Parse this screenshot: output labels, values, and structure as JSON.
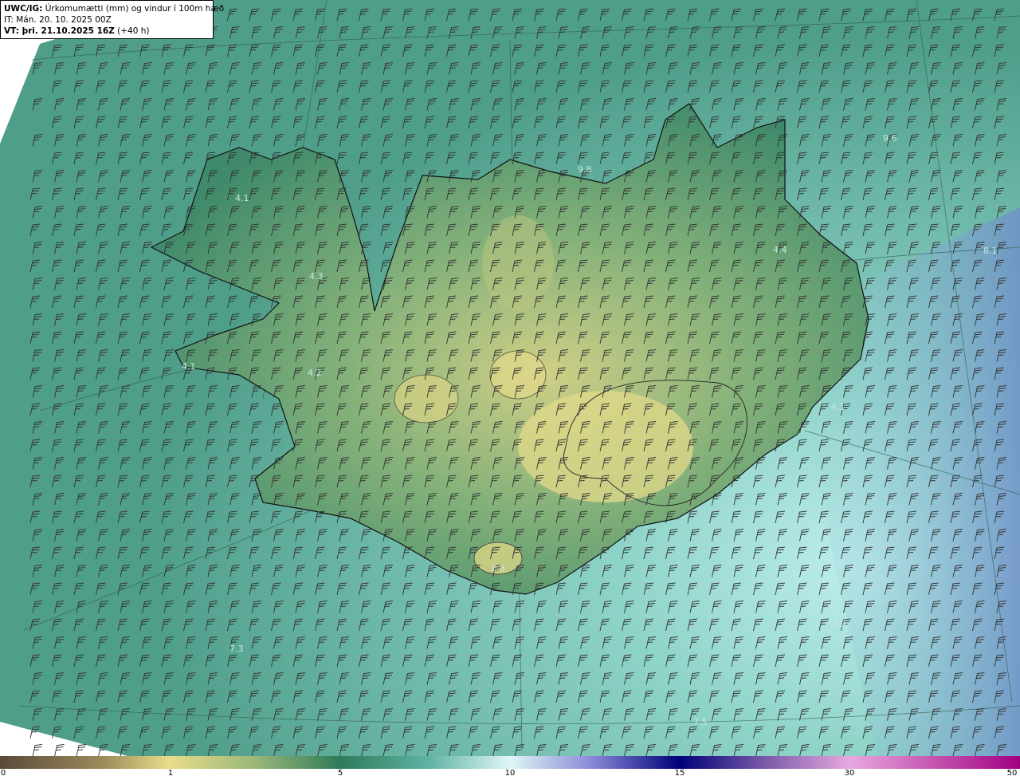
{
  "header": {
    "model_label": "UWC/IG:",
    "title": "Úrkomumætti (mm) og vindur í 100m hæð",
    "it_label": "IT:",
    "it_value": "Mán. 20. 10. 2025 00Z",
    "vt_label": "VT: þri. 21.10.2025 16Z",
    "vt_offset": "(+40 h)"
  },
  "map": {
    "values": [
      "4.1",
      "4.4",
      "4.1",
      "4.3",
      "4.2",
      "4.1",
      "2.8",
      "7.3",
      "7.5",
      "7.9",
      "9.6",
      "8.1",
      "9.8"
    ],
    "land_colors": {
      "ocean": "#5fb3a4",
      "ocean_light": "#a8e0da",
      "land_high": "#3f8a6b",
      "land_mid": "#7fb07a",
      "land_dry": "#d7d68f"
    }
  },
  "colorbar": {
    "ticks": [
      "0",
      "1",
      "5",
      "10",
      "15",
      "30",
      "50"
    ],
    "colors": [
      "#5a4a3a",
      "#c8b86a",
      "#e8e08a",
      "#2e7a5a",
      "#5fb3a4",
      "#dff6f6",
      "#6a6ad0",
      "#00007a",
      "#8040a0",
      "#e080d0",
      "#a00080"
    ]
  }
}
